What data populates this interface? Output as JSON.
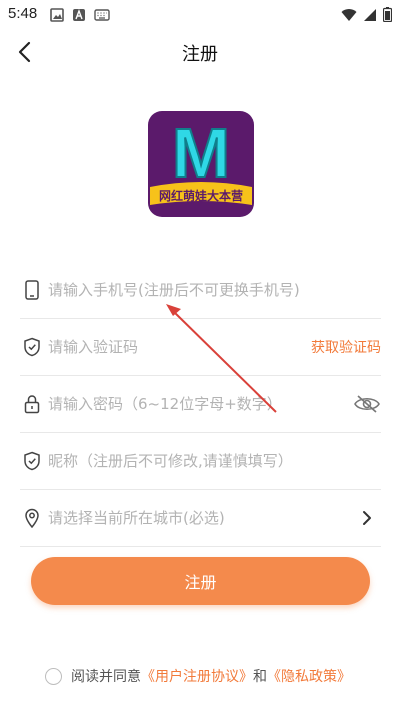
{
  "status_bar": {
    "time": "5:48",
    "left_icons": [
      "image-icon",
      "a-icon",
      "keyboard-icon"
    ],
    "right_icons": [
      "wifi-icon",
      "signal-icon",
      "battery-icon"
    ]
  },
  "header": {
    "title": "注册",
    "back_icon": "chevron-left-icon"
  },
  "logo": {
    "letter": "M",
    "text": "网红萌娃大本营"
  },
  "form": {
    "phone_placeholder": "请输入手机号(注册后不可更换手机号)",
    "code_placeholder": "请输入验证码",
    "get_code_label": "获取验证码",
    "password_placeholder": "请输入密码（6~12位字母+数字）",
    "nickname_placeholder": "昵称（注册后不可修改,请谨慎填写）",
    "city_placeholder": "请选择当前所在城市(必选)"
  },
  "submit_label": "注册",
  "agreement": {
    "prefix": "阅读并同意",
    "user_agreement": "《用户注册协议》",
    "and": "和",
    "privacy_policy": "《隐私政策》"
  },
  "colors": {
    "accent": "#f48a4c",
    "link": "#f27a3a",
    "logo_bg": "#5b1a6b",
    "logo_letter": "#2fd8e6",
    "logo_banner": "#f7c21a",
    "annotation_arrow": "#d9413a"
  }
}
